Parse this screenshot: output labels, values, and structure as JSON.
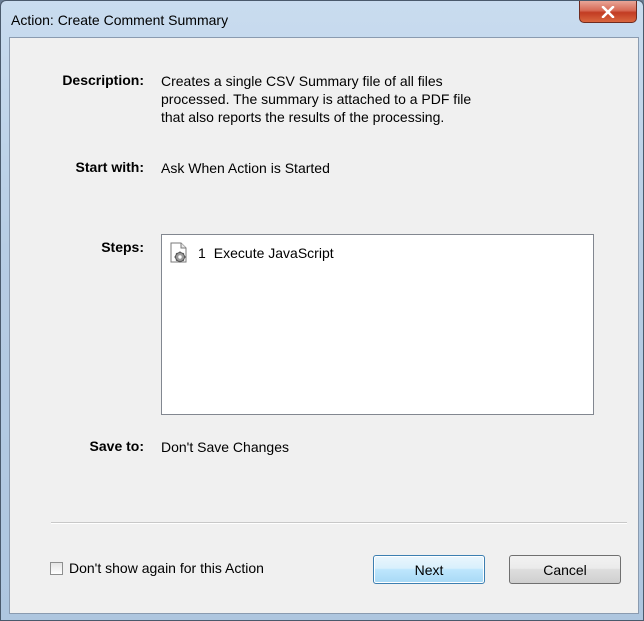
{
  "window": {
    "title": "Action: Create Comment Summary"
  },
  "description": {
    "label": "Description:",
    "lines": [
      "Creates a single CSV Summary file of all files",
      "processed.  The summary is attached to a PDF file",
      "that also reports the results of the processing."
    ]
  },
  "start_with": {
    "label": "Start with:",
    "value": "Ask When Action is Started"
  },
  "steps": {
    "label": "Steps:",
    "items": [
      {
        "number": "1",
        "label": "Execute JavaScript",
        "icon": "script-gear-icon"
      }
    ]
  },
  "save_to": {
    "label": "Save to:",
    "value": "Don't Save Changes"
  },
  "footer": {
    "checkbox_label": "Don't show again for this Action",
    "checkbox_checked": false,
    "next_label": "Next",
    "cancel_label": "Cancel"
  },
  "colors": {
    "close_button": "#c23b22",
    "default_button_border": "#3c7fb1"
  }
}
